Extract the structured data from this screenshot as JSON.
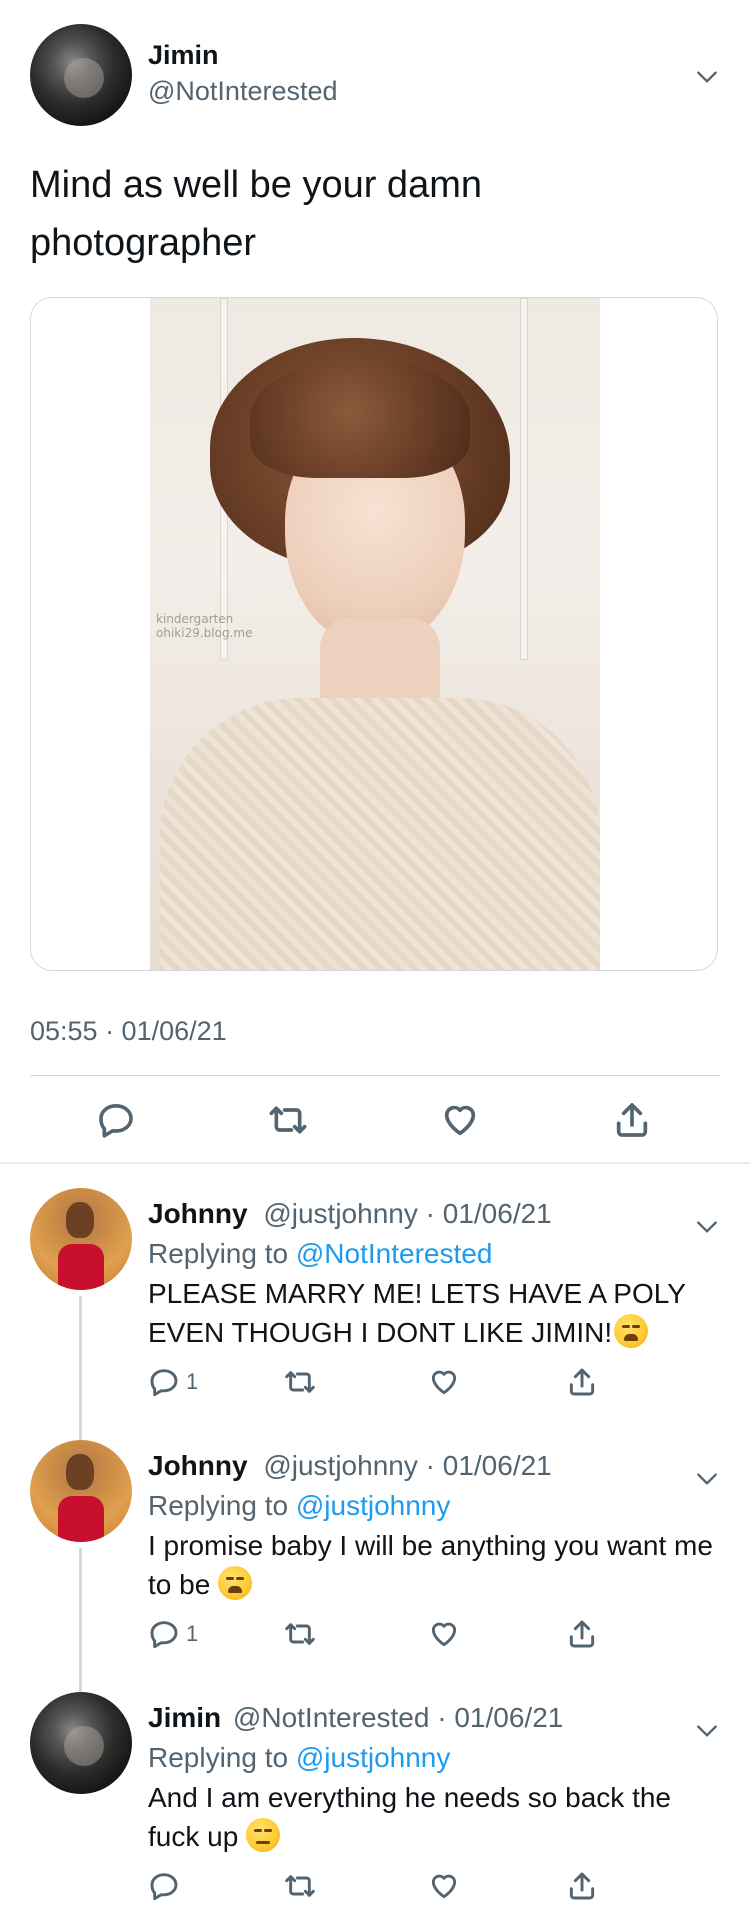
{
  "main_tweet": {
    "author_name": "Jimin",
    "author_handle": "@NotInterested",
    "text": "Mind as well be your damn photographer",
    "media_watermark": "kindergarten\nohiki29.blog.me",
    "timestamp": "05:55 · 01/06/21"
  },
  "replies": [
    {
      "author_name": "Johnny",
      "author_handle": "@justjohnny",
      "separator": "·",
      "date": "01/06/21",
      "replying_prefix": "Replying to",
      "replying_to": "@NotInterested",
      "text": "PLEASE MARRY ME! LETS HAVE A POLY EVEN THOUGH I DONT LIKE JIMIN!",
      "emoji": "weary-face-emoji",
      "reply_count": "1"
    },
    {
      "author_name": "Johnny",
      "author_handle": "@justjohnny",
      "separator": "·",
      "date": "01/06/21",
      "replying_prefix": "Replying to",
      "replying_to": "@justjohnny",
      "text": "I promise baby I will be anything you want me to be",
      "emoji": "weary-face-emoji",
      "reply_count": "1"
    },
    {
      "author_name": "Jimin",
      "author_handle": "@NotInterested",
      "separator": "·",
      "date": "01/06/21",
      "replying_prefix": "Replying to",
      "replying_to": "@justjohnny",
      "text": "And I am everything he needs so back the fuck up",
      "emoji": "unamused-face-emoji",
      "reply_count": ""
    }
  ],
  "colors": {
    "text": "#0f1419",
    "secondary": "#536471",
    "link": "#1d9bf0",
    "divider": "#cfd9de"
  },
  "icons": [
    "reply-icon",
    "retweet-icon",
    "like-icon",
    "share-icon",
    "chevron-down-icon"
  ]
}
